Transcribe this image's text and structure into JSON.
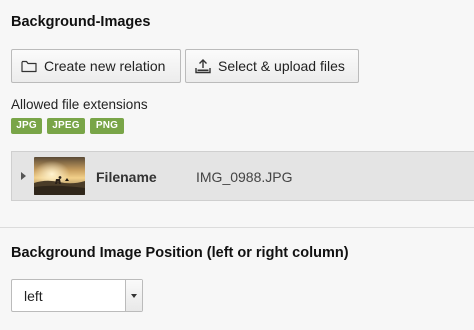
{
  "section_background": {
    "title": "Background-Images",
    "buttons": {
      "create_relation": "Create new relation",
      "select_upload": "Select & upload files"
    },
    "allowed_extensions_label": "Allowed file extensions",
    "extensions": [
      "JPG",
      "JPEG",
      "PNG"
    ],
    "file": {
      "field_label": "Filename",
      "filename": "IMG_0988.JPG"
    }
  },
  "section_position": {
    "title": "Background Image Position (left or right column)",
    "select": {
      "selected": "left"
    }
  },
  "icons": {
    "folder": "folder-icon",
    "upload": "upload-icon",
    "expand": "caret-right-icon",
    "dropdown": "chevron-down-icon"
  },
  "colors": {
    "badge": "#79a548",
    "file_row": "#e4e4e4"
  }
}
